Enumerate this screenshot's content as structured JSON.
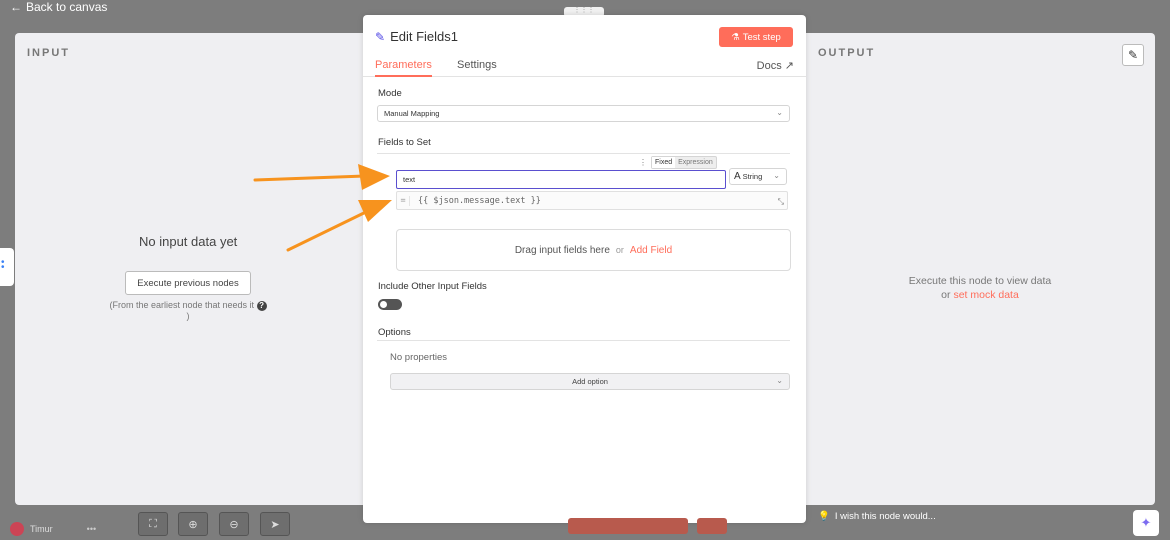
{
  "nav": {
    "back_label": "Back to canvas"
  },
  "input_panel": {
    "title": "INPUT",
    "empty_title": "No input data yet",
    "execute_button": "Execute previous nodes",
    "hint": "(From the earliest node that needs it",
    "hint_end": ")"
  },
  "output_panel": {
    "title": "OUTPUT",
    "execute_text": "Execute this node to view data",
    "or_text": "or",
    "mock_link": "set mock data"
  },
  "node": {
    "title": "Edit Fields1",
    "test_button": "Test step",
    "tabs": [
      {
        "label": "Parameters",
        "active": true
      },
      {
        "label": "Settings",
        "active": false
      }
    ],
    "docs_label": "Docs",
    "mode_label": "Mode",
    "mode_value": "Manual Mapping",
    "fields_label": "Fields to Set",
    "fixed_label": "Fixed",
    "expression_label": "Expression",
    "field_name": "text",
    "field_type": "String",
    "field_value": "{{ $json.message.text }}",
    "dropzone_text": "Drag input fields here",
    "dropzone_or": "or",
    "add_field": "Add Field",
    "include_label": "Include Other Input Fields",
    "include_enabled": false,
    "options_label": "Options",
    "no_properties": "No properties",
    "add_option": "Add option"
  },
  "footer": {
    "user_name": "Timur",
    "wish_text": "I wish this node would..."
  },
  "colors": {
    "accent": "#ff6d5a",
    "focus": "#5a4fcf",
    "arrow": "#f7931e"
  }
}
